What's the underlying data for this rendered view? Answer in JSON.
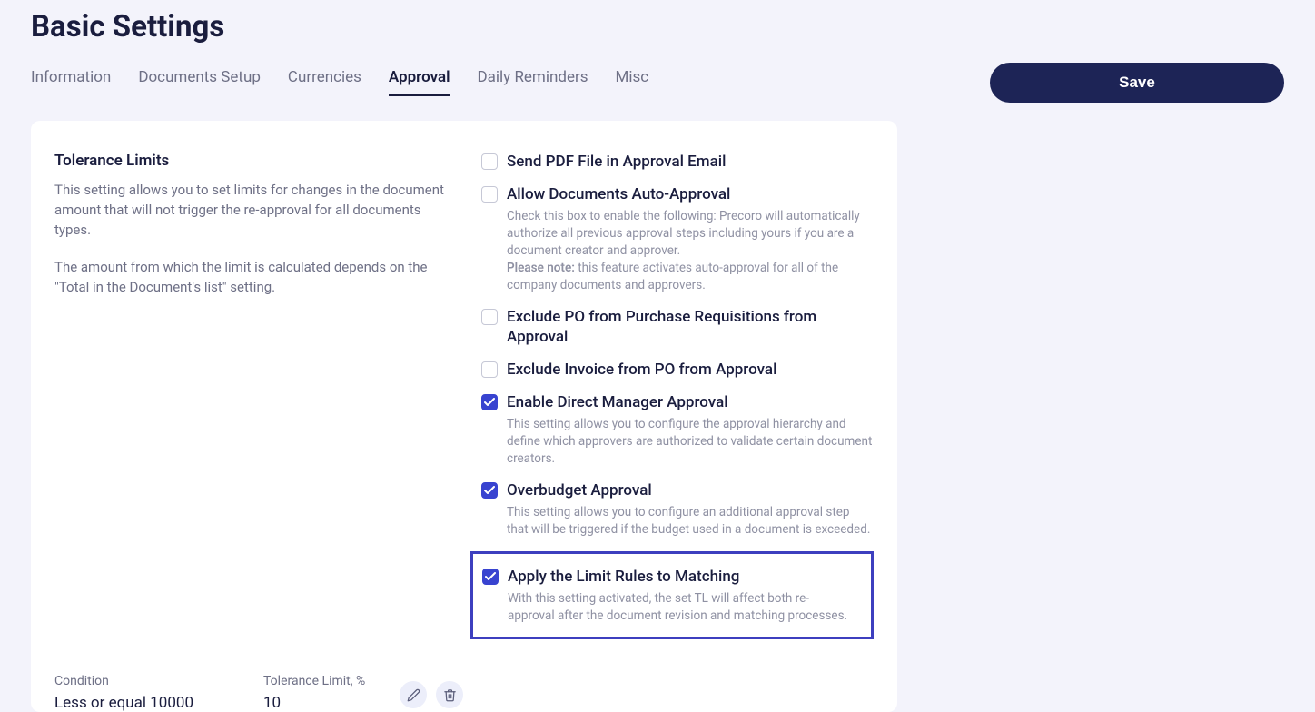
{
  "pageTitle": "Basic Settings",
  "tabs": {
    "information": "Information",
    "documentsSetup": "Documents Setup",
    "currencies": "Currencies",
    "approval": "Approval",
    "dailyReminders": "Daily Reminders",
    "misc": "Misc"
  },
  "saveLabel": "Save",
  "tolerance": {
    "title": "Tolerance Limits",
    "desc1": "This setting allows you to set limits for changes in the document amount that will not trigger the re-approval for all documents types.",
    "desc2": "The amount from which the limit is calculated depends on the \"Total in the Document's list\" setting."
  },
  "checks": {
    "sendPdf": {
      "label": "Send PDF File in Approval Email"
    },
    "autoApproval": {
      "label": "Allow Documents Auto-Approval",
      "desc": "Check this box to enable the following: Precoro will automatically authorize all previous approval steps including yours if you are a document creator and approver.",
      "noteLabel": "Please note:",
      "noteText": " this feature activates auto-approval for all of the company documents and approvers."
    },
    "excludePo": {
      "label": "Exclude PO from Purchase Requisitions from Approval"
    },
    "excludeInvoice": {
      "label": "Exclude Invoice from PO from Approval"
    },
    "directManager": {
      "label": "Enable Direct Manager Approval",
      "desc": "This setting allows you to configure the approval hierarchy and define which approvers are authorized to validate certain document creators."
    },
    "overbudget": {
      "label": "Overbudget Approval",
      "desc": "This setting allows you to configure an additional approval step that will be triggered if the budget used in a document is exceeded."
    },
    "applyLimit": {
      "label": "Apply the Limit Rules to Matching",
      "desc": "With this setting activated, the set TL will affect both re-approval after the document revision and matching processes."
    }
  },
  "table": {
    "conditionHeader": "Condition",
    "conditionValue": "Less or equal 10000",
    "toleranceHeader": "Tolerance Limit, %",
    "toleranceValue": "10"
  }
}
